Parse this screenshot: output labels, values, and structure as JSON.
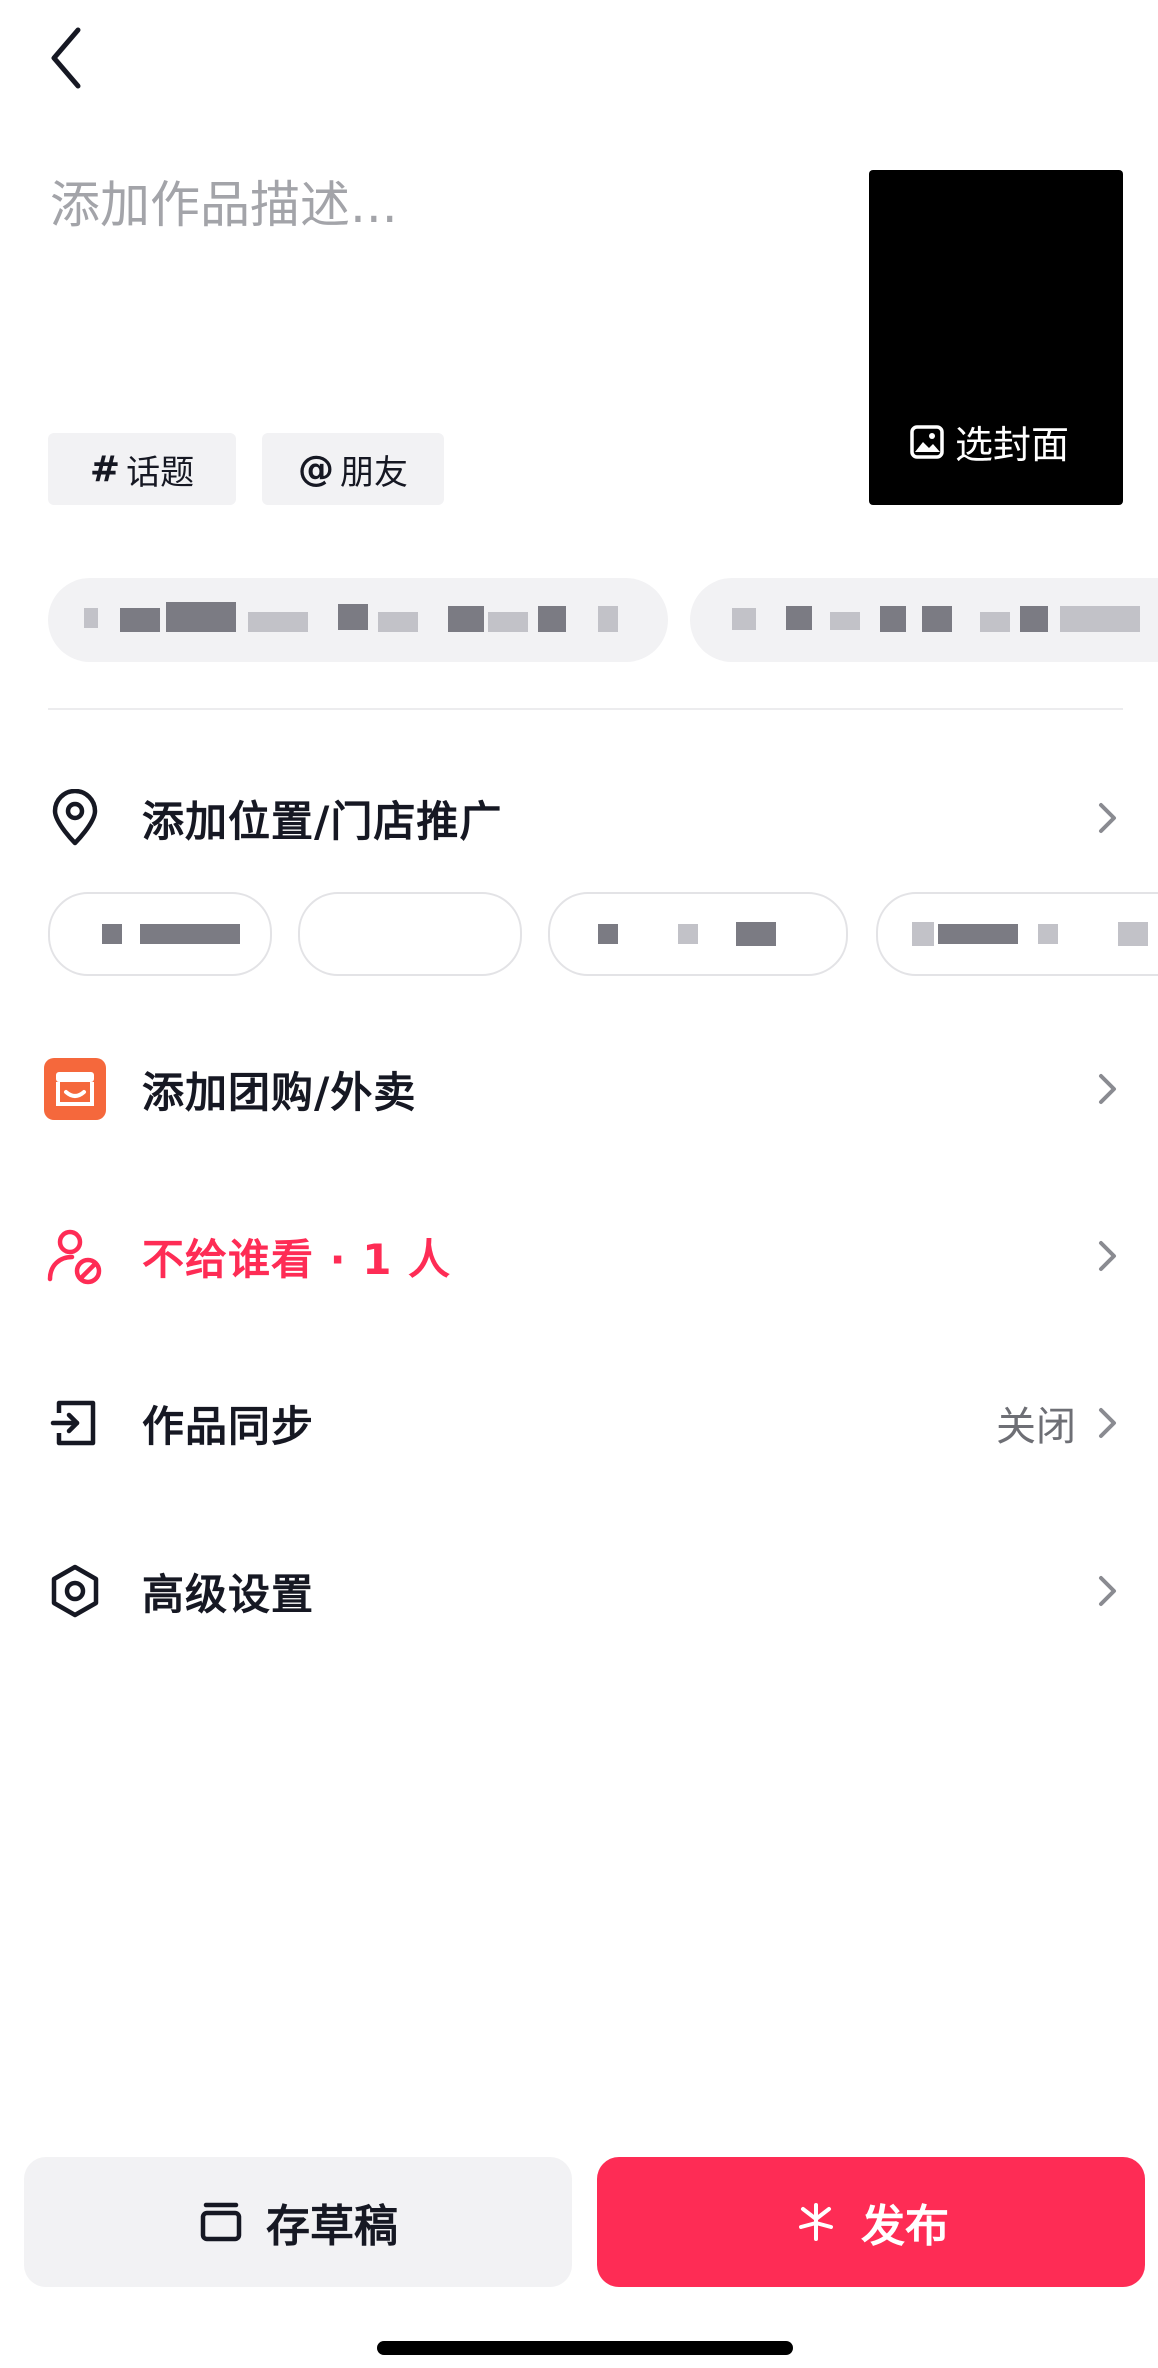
{
  "description": {
    "placeholder": "添加作品描述..."
  },
  "cover": {
    "label": "选封面",
    "icon": "image-icon"
  },
  "chips": [
    {
      "symbol": "#",
      "label": "话题"
    },
    {
      "symbol": "@",
      "label": "朋友"
    }
  ],
  "location": {
    "label": "添加位置/门店推广",
    "icon": "location-pin-icon"
  },
  "groupbuy": {
    "label": "添加团购/外卖",
    "icon": "shop-icon",
    "icon_color": "#f5683c"
  },
  "privacy": {
    "label": "不给谁看 · 1 人",
    "icon": "user-block-icon",
    "color": "#fe2c55"
  },
  "sync": {
    "label": "作品同步",
    "value": "关闭",
    "icon": "exit-box-icon"
  },
  "advanced": {
    "label": "高级设置",
    "icon": "hexagon-gear-icon"
  },
  "footer": {
    "draft_label": "存草稿",
    "draft_icon": "draft-box-icon",
    "publish_label": "发布",
    "publish_icon": "sparkle-icon",
    "publish_color": "#fe2c55"
  }
}
